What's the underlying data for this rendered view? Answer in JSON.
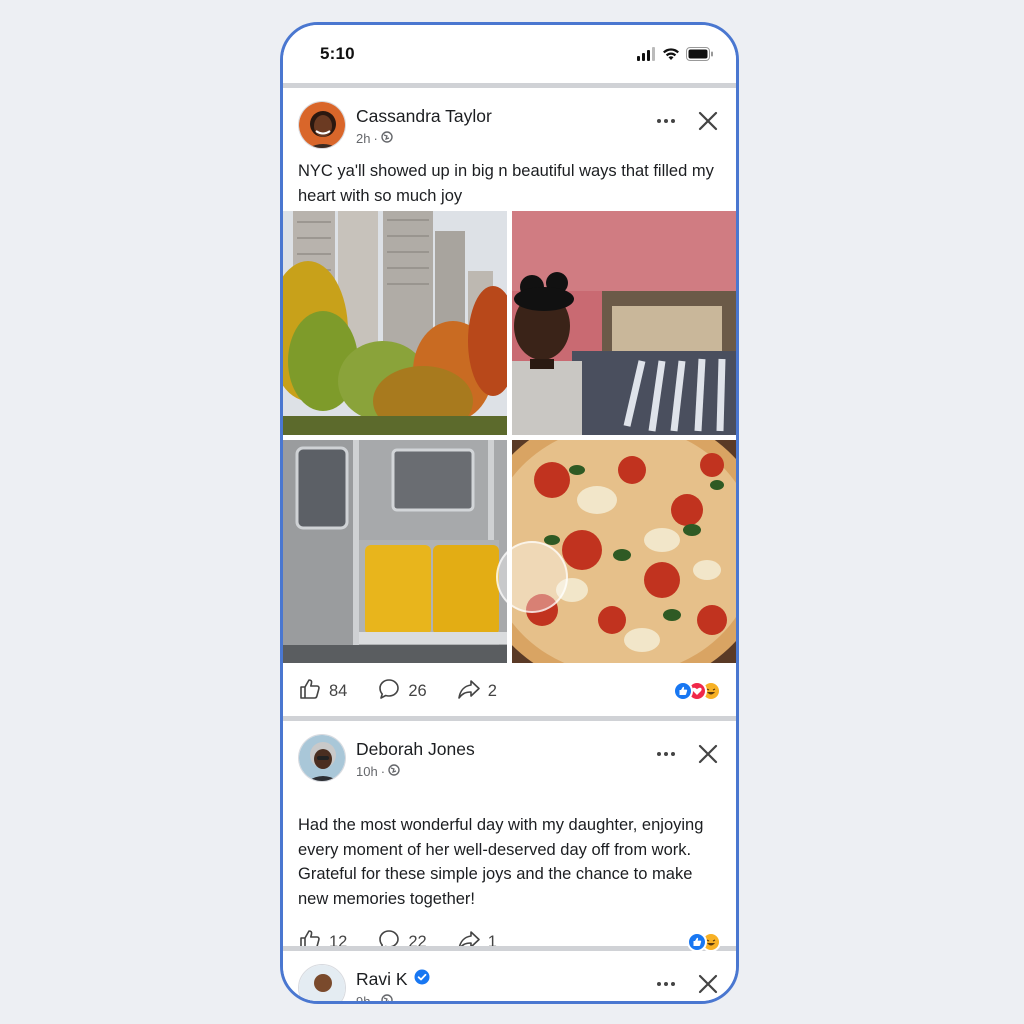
{
  "status_bar": {
    "time": "5:10",
    "icons": [
      "cellular-signal-icon",
      "wifi-icon",
      "battery-icon"
    ]
  },
  "colors": {
    "frame": "#4a77d0",
    "like_blue": "#1877f2",
    "love_red": "#f0284a",
    "haha_yellow": "#f7b125",
    "text": "#1c1e21",
    "muted": "#65676b"
  },
  "posts": [
    {
      "author": "Cassandra Taylor",
      "time": "2h",
      "privacy_icon": "globe-icon",
      "text": "NYC ya'll showed up in big n beautiful ways that filled my heart with so much joy",
      "images": [
        "autumn-trees-and-skyscrapers",
        "woman-at-clothing-rack",
        "subway-car-yellow-seats",
        "pizza"
      ],
      "likes": "84",
      "comments": "26",
      "shares": "2",
      "reactions": [
        "like",
        "love",
        "haha"
      ]
    },
    {
      "author": "Deborah Jones",
      "time": "10h",
      "privacy_icon": "globe-icon",
      "text": "Had the most wonderful day with my daughter, enjoying every moment of her well-deserved day off from work. Grateful for these simple joys and the chance to make new memories together!",
      "likes": "12",
      "comments": "22",
      "shares": "1",
      "reactions": [
        "like",
        "haha"
      ]
    },
    {
      "author": "Ravi K",
      "verified": true,
      "time": "9h"
    }
  ]
}
